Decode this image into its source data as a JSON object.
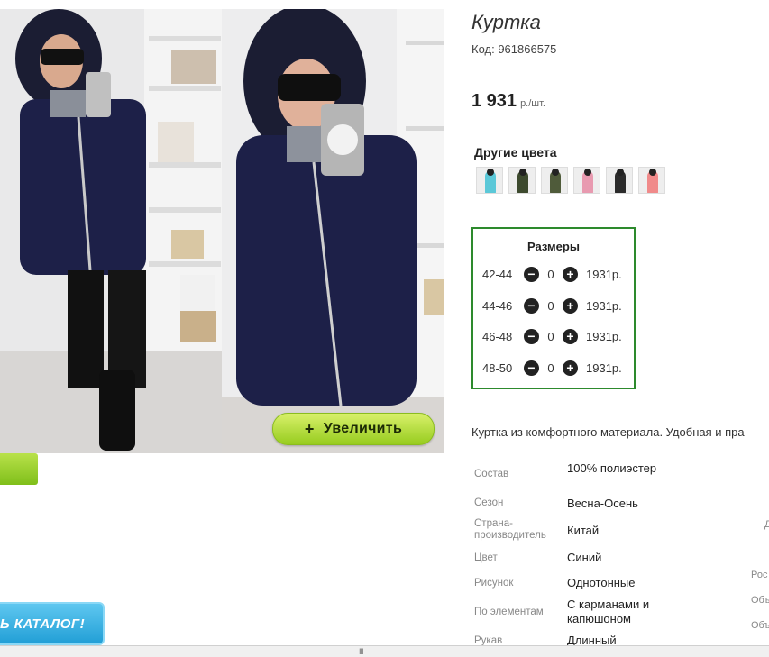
{
  "product": {
    "title": "Куртка",
    "code": "Код: 961866575",
    "price": "1 931",
    "price_unit": "р./шт."
  },
  "gallery": {
    "zoom_label": "Увеличить",
    "zoom_plus": "+"
  },
  "catalog_button": "Ь КАТАЛОГ!",
  "colors": {
    "title": "Другие цвета",
    "swatch_colors": [
      "#5bc8d8",
      "#3d4a2e",
      "#4f5b3a",
      "#e89ab0",
      "#2b2b2b",
      "#f08a8a"
    ]
  },
  "sizes": {
    "title": "Размеры",
    "rows": [
      {
        "size": "42-44",
        "qty": "0",
        "price": "1931р."
      },
      {
        "size": "44-46",
        "qty": "0",
        "price": "1931р."
      },
      {
        "size": "46-48",
        "qty": "0",
        "price": "1931р."
      },
      {
        "size": "48-50",
        "qty": "0",
        "price": "1931р."
      }
    ],
    "minus": "−",
    "plus": "+"
  },
  "description": "Куртка из комфортного материала. Удобная и пра",
  "specs": [
    {
      "key": "Состав",
      "value": "100% полиэстер"
    },
    {
      "key": "Сезон",
      "value": "Весна-Осень"
    },
    {
      "key": "Страна-производитель",
      "value": "Китай"
    },
    {
      "key": "Цвет",
      "value": "Синий"
    },
    {
      "key": "Рисунок",
      "value": "Однотонные"
    },
    {
      "key": "По элементам",
      "value": "С карманами и капюшоном"
    },
    {
      "key": "Рукав",
      "value": "Длинный"
    }
  ],
  "right_edge_labels": [
    "Д",
    "Рос",
    "Объ",
    "Объ"
  ],
  "scroll_grip": "III",
  "accent_colors": {
    "green_border": "#2d8a2d",
    "button_green": "#97cc1f",
    "catalog_blue": "#229fd6"
  }
}
